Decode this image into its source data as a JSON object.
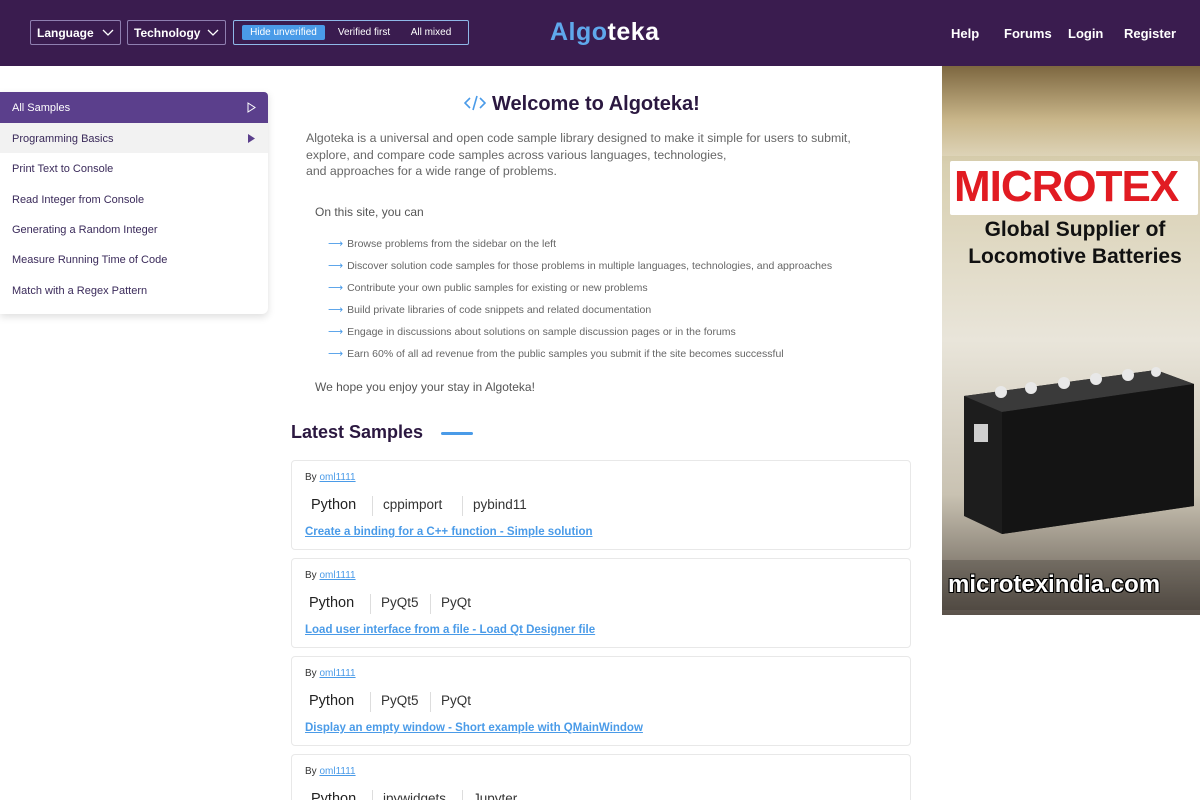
{
  "header": {
    "language_label": "Language",
    "technology_label": "Technology",
    "filter": {
      "hide_unverified": "Hide unverified",
      "verified_first": "Verified first",
      "all_mixed": "All mixed"
    },
    "logo_part1": "Algo",
    "logo_part2": "teka",
    "nav": {
      "help": "Help",
      "forums": "Forums",
      "login": "Login",
      "register": "Register"
    }
  },
  "sidebar": {
    "all_samples": "All Samples",
    "category": "Programming Basics",
    "items": [
      "Print Text to Console",
      "Read Integer from Console",
      "Generating a Random Integer",
      "Measure Running Time of Code",
      "Match with a Regex Pattern"
    ]
  },
  "main": {
    "title": "Welcome to Algoteka!",
    "intro_1": "Algoteka is a universal and open code sample library designed to make it simple for users to submit,",
    "intro_2": "explore, and compare code samples across various languages, technologies,",
    "intro_3": "and approaches for a wide range of problems.",
    "on_site": "On this site, you can",
    "features": [
      "Browse problems from the sidebar on the left",
      "Discover solution code samples for those problems in multiple languages, technologies, and approaches",
      "Contribute your own public samples for existing or new problems",
      "Build private libraries of code snippets and related documentation",
      "Engage in discussions about solutions on sample discussion pages or in the forums",
      "Earn 60% of all ad revenue from the public samples you submit if the site becomes successful"
    ],
    "hope": "We hope you enjoy your stay in Algoteka!",
    "latest_title": "Latest Samples"
  },
  "samples": [
    {
      "by": "By",
      "user": "oml1111",
      "tags": [
        "Python",
        "cppimport",
        "pybind11"
      ],
      "link": "Create a binding for a C++ function - Simple solution"
    },
    {
      "by": "By",
      "user": "oml1111",
      "tags": [
        "Python",
        "PyQt5",
        "PyQt"
      ],
      "link": "Load user interface from a file - Load Qt Designer file"
    },
    {
      "by": "By",
      "user": "oml1111",
      "tags": [
        "Python",
        "PyQt5",
        "PyQt"
      ],
      "link": "Display an empty window - Short example with QMainWindow"
    },
    {
      "by": "By",
      "user": "oml1111",
      "tags": [
        "Python",
        "ipywidgets",
        "Jupyter"
      ],
      "link": ""
    }
  ],
  "ad": {
    "brand": "MICROTEX",
    "tagline_1": "Global Supplier of",
    "tagline_2": "Locomotive Batteries",
    "url": "microtexindia.com"
  },
  "colors": {
    "header_bg": "#3a1c4f",
    "accent": "#4a9be8",
    "sidebar_active": "#5b3f8c",
    "ad_brand": "#e11b22"
  }
}
